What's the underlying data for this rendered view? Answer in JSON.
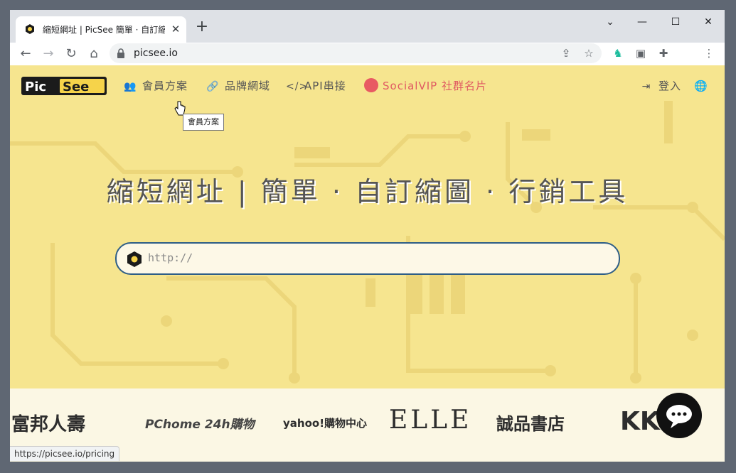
{
  "browser": {
    "tab_title": "縮短網址 | PicSee 簡單 · 自訂縮圖",
    "tab_close": "✕",
    "new_tab": "+",
    "url": "picsee.io",
    "status_url": "https://picsee.io/pricing",
    "controls": {
      "minimize": "—",
      "maximize": "☐",
      "close": "✕",
      "tab_search": "⌄"
    }
  },
  "nav": {
    "logo": "PicSee",
    "items": [
      {
        "icon": "users-icon",
        "label": "會員方案"
      },
      {
        "icon": "link-icon",
        "label": "品牌網域"
      },
      {
        "icon": "code-icon",
        "label": "API串接"
      },
      {
        "icon": "socialvip-icon",
        "label": "SocialVIP 社群名片"
      }
    ],
    "login": "登入",
    "tooltip": "會員方案"
  },
  "hero": {
    "headline": "縮短網址 | 簡單 · 自訂縮圖 · 行銷工具",
    "search_placeholder": "http://"
  },
  "partners": [
    "富邦人壽",
    "PChome 24h購物",
    "yahoo!購物中心",
    "ELLE",
    "誠品書店",
    "KKTV"
  ],
  "colors": {
    "background": "#f6e58f",
    "accent": "#2d5d86",
    "social": "#e85a63"
  }
}
